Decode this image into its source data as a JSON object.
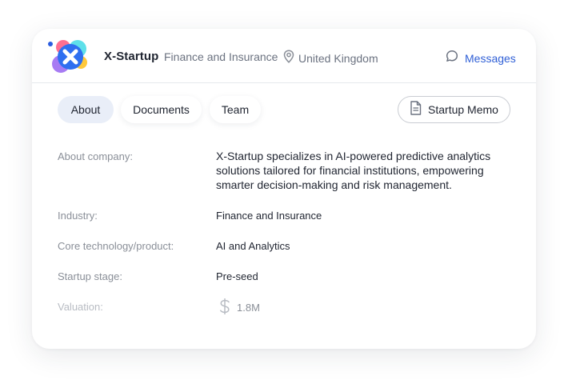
{
  "header": {
    "company_name": "X-Startup",
    "industry": "Finance and Insurance",
    "location": "United Kingdom",
    "messages_label": "Messages"
  },
  "tabs": [
    {
      "label": "About",
      "active": true
    },
    {
      "label": "Documents",
      "active": false
    },
    {
      "label": "Team",
      "active": false
    }
  ],
  "memo_button": {
    "label": "Startup Memo"
  },
  "details": {
    "about": {
      "label": "About company:",
      "value": "X-Startup specializes in AI-powered predictive analytics solutions tailored for financial institutions, empowering smarter decision-making and risk management."
    },
    "industry": {
      "label": "Industry:",
      "value": "Finance and Insurance"
    },
    "core_tech": {
      "label": "Core technology/product:",
      "value": "AI and Analytics"
    },
    "stage": {
      "label": "Startup stage:",
      "value": "Pre-seed"
    },
    "valuation": {
      "label": "Valuation:",
      "value": "1.8M"
    }
  },
  "icons": {
    "logo": "x-startup-logo",
    "location": "map-pin-icon",
    "messages": "chat-bubble-icon",
    "memo": "document-icon",
    "valuation": "dollar-icon"
  },
  "colors": {
    "accent": "#2f5fd6",
    "active_tab_bg": "#e9eef8",
    "label_text": "#8a8f98",
    "body_text": "#1f2430"
  }
}
